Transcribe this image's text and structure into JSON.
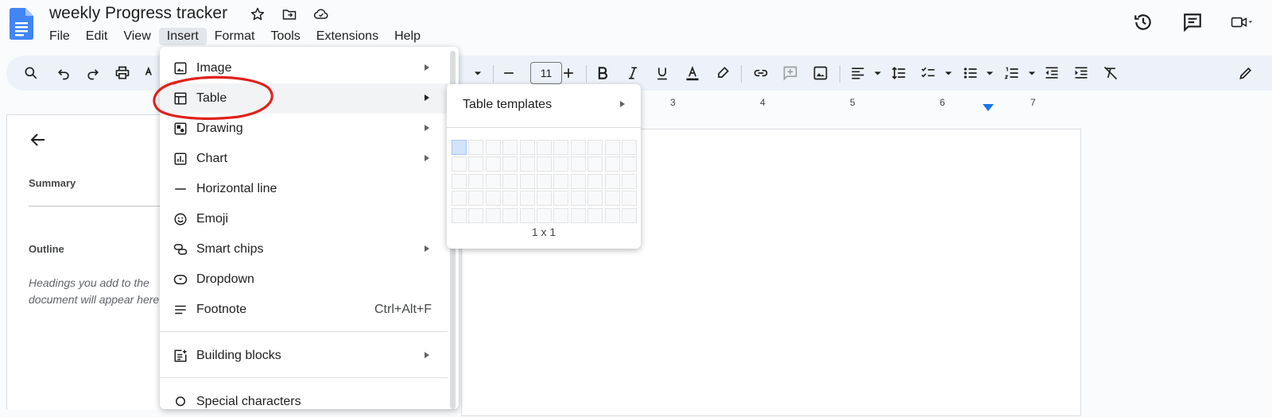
{
  "document": {
    "title": "weekly Progress tracker"
  },
  "menubar": {
    "items": [
      "File",
      "Edit",
      "View",
      "Insert",
      "Format",
      "Tools",
      "Extensions",
      "Help"
    ],
    "active": "Insert"
  },
  "toolbar": {
    "font_size": "11"
  },
  "ruler": {
    "numbers": [
      "3",
      "4",
      "5",
      "6",
      "7"
    ]
  },
  "left_panel": {
    "summary_label": "Summary",
    "outline_label": "Outline",
    "outline_hint": "Headings you add to the document will appear here."
  },
  "insert_menu": {
    "items": [
      {
        "label": "Image",
        "icon": "image-icon",
        "has_submenu": true
      },
      {
        "label": "Table",
        "icon": "table-icon",
        "has_submenu": true,
        "highlighted": true
      },
      {
        "label": "Drawing",
        "icon": "drawing-icon",
        "has_submenu": true
      },
      {
        "label": "Chart",
        "icon": "chart-icon",
        "has_submenu": true
      },
      {
        "label": "Horizontal line",
        "icon": "horizontal-line-icon",
        "has_submenu": false
      },
      {
        "label": "Emoji",
        "icon": "emoji-icon",
        "has_submenu": false
      },
      {
        "label": "Smart chips",
        "icon": "smart-chips-icon",
        "has_submenu": true
      },
      {
        "label": "Dropdown",
        "icon": "dropdown-icon",
        "has_submenu": false
      },
      {
        "label": "Footnote",
        "icon": "footnote-icon",
        "has_submenu": false,
        "shortcut": "Ctrl+Alt+F"
      },
      {
        "label": "Building blocks",
        "icon": "building-blocks-icon",
        "has_submenu": true
      },
      {
        "label": "Special characters",
        "icon": "special-characters-icon",
        "has_submenu": false
      }
    ]
  },
  "table_submenu": {
    "templates_label": "Table templates",
    "grid_columns": 11,
    "grid_rows": 5,
    "selected": [
      1,
      1
    ],
    "size_label": "1 x 1"
  },
  "colors": {
    "accent": "#1a73e8",
    "annotation": "#e0211b",
    "toolbar_bg": "#edf2fa"
  }
}
